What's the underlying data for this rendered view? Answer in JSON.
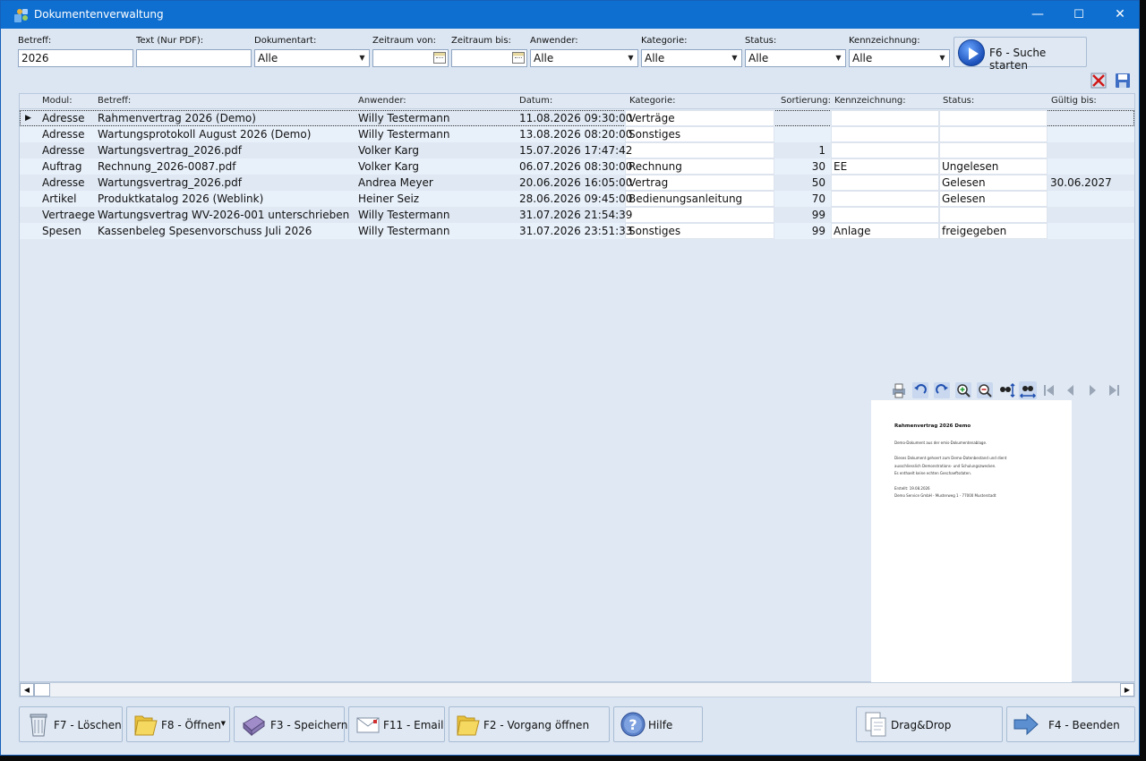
{
  "window": {
    "title": "Dokumentenverwaltung",
    "controls": [
      "—",
      "☐",
      "✕"
    ]
  },
  "filters": {
    "betreff": {
      "label": "Betreff:",
      "value": "2026"
    },
    "text": {
      "label": "Text (Nur PDF):",
      "value": ""
    },
    "dokumentart": {
      "label": "Dokumentart:",
      "value": "Alle"
    },
    "zeitraum_von": {
      "label": "Zeitraum von:",
      "value": ""
    },
    "zeitraum_bis": {
      "label": "Zeitraum bis:",
      "value": ""
    },
    "anwender": {
      "label": "Anwender:",
      "value": "Alle"
    },
    "kategorie": {
      "label": "Kategorie:",
      "value": "Alle"
    },
    "status": {
      "label": "Status:",
      "value": "Alle"
    },
    "kennzeichnung": {
      "label": "Kennzeichnung:",
      "value": "Alle"
    },
    "search_button": "F6 - Suche starten"
  },
  "grid": {
    "columns": [
      "Modul:",
      "Betreff:",
      "Anwender:",
      "Datum:",
      "Kategorie:",
      "Sortierung:",
      "Kennzeichnung:",
      "Status:",
      "Gültig bis:"
    ],
    "rows": [
      [
        "Adresse",
        "Rahmenvertrag 2026 (Demo)",
        "Willy Testermann",
        "11.08.2026 09:30:00",
        "Verträge",
        "",
        "",
        "",
        ""
      ],
      [
        "Adresse",
        "Wartungsprotokoll August 2026 (Demo)",
        "Willy Testermann",
        "13.08.2026 08:20:00",
        "Sonstiges",
        "",
        "",
        "",
        ""
      ],
      [
        "Adresse",
        "Wartungsvertrag_2026.pdf",
        "Volker Karg",
        "15.07.2026 17:47:42",
        "",
        "1",
        "",
        "",
        ""
      ],
      [
        "Auftrag",
        "Rechnung_2026-0087.pdf",
        "Volker Karg",
        "06.07.2026 08:30:00",
        "Rechnung",
        "30",
        "EE",
        "Ungelesen",
        ""
      ],
      [
        "Adresse",
        "Wartungsvertrag_2026.pdf",
        "Andrea Meyer",
        "20.06.2026 16:05:00",
        "Vertrag",
        "50",
        "",
        "Gelesen",
        "30.06.2027"
      ],
      [
        "Artikel",
        "Produktkatalog 2026 (Weblink)",
        "Heiner Seiz",
        "28.06.2026 09:45:00",
        "Bedienungsanleitung",
        "70",
        "",
        "Gelesen",
        ""
      ],
      [
        "Vertraege",
        "Wartungsvertrag WV-2026-001 unterschrieben",
        "Willy Testermann",
        "31.07.2026 21:54:39",
        "",
        "99",
        "",
        "",
        ""
      ],
      [
        "Spesen",
        "Kassenbeleg Spesenvorschuss Juli 2026",
        "Willy Testermann",
        "31.07.2026 23:51:33",
        "Sonstiges",
        "99",
        "Anlage",
        "freigegeben",
        ""
      ]
    ]
  },
  "preview": {
    "title": "Rahmenvertrag 2026 Demo",
    "lines": [
      "Demo-Dokument aus der emis-Dokumentenablage.",
      "Dieses Dokument gehoert zum Demo-Datenbestand und dient",
      "ausschliesslich Demonstrations- und Schulungszwecken.",
      "Es enthaelt keine echten Geschaeftsdaten.",
      "Erstellt: 19.08.2026",
      "Demo Service GmbH - Musterweg 1 - 77000 Musterstadt"
    ]
  },
  "buttons": {
    "delete": "F7 - Löschen",
    "open": "F8 - Öffnen",
    "save": "F3 - Speichern",
    "email": "F11 - Email",
    "open_process": "F2 - Vorgang öffnen",
    "help": "Hilfe",
    "dragdrop": "Drag&Drop",
    "exit": "F4 - Beenden"
  },
  "colors": {
    "titlebar": "#0f6fd0",
    "background": "#dce6f2",
    "row_alt": "#e8f0fa"
  }
}
